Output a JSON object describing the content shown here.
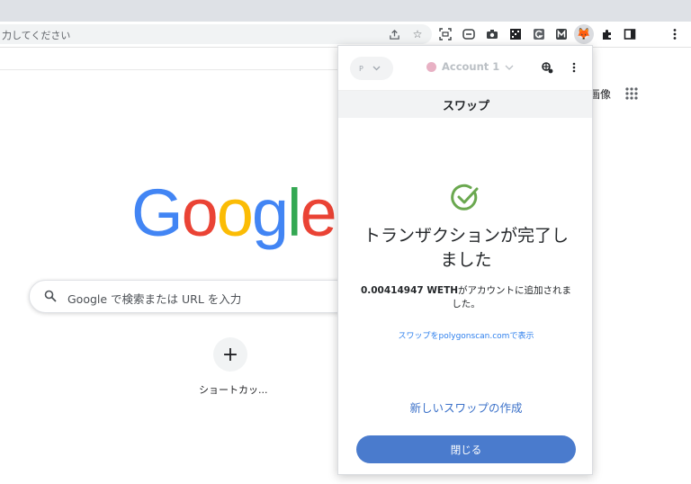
{
  "browser": {
    "omnibox_text": "力してください"
  },
  "google": {
    "logo_letters": [
      {
        "ch": "G",
        "color": "#4285f4"
      },
      {
        "ch": "o",
        "color": "#ea4335"
      },
      {
        "ch": "o",
        "color": "#fbbc05"
      },
      {
        "ch": "g",
        "color": "#4285f4"
      },
      {
        "ch": "l",
        "color": "#34a853"
      },
      {
        "ch": "e",
        "color": "#ea4335"
      }
    ],
    "images_link": "画像",
    "search_placeholder": "Google で検索または URL を入力",
    "shortcut_add_icon": "+",
    "shortcut_label": "ショートカッ..."
  },
  "metamask": {
    "network_label": "P",
    "account_name": "Account 1",
    "title": "スワップ",
    "result_title": "トランザクションが完了しました",
    "amount": "0.00414947 WETH",
    "amount_suffix": "がアカウントに追加されました。",
    "explorer_link": "スワップをpolygonscan.comで表示",
    "new_swap": "新しいスワップの作成",
    "close_button": "閉じる",
    "colors": {
      "primary": "#4a7bcd",
      "success": "#6aa84f",
      "link": "#2f80ed"
    }
  },
  "icons": [
    "share-icon",
    "star-icon",
    "screenshot-icon",
    "extension-icon",
    "camera-icon",
    "qr-icon",
    "grammarly-icon",
    "m-icon",
    "metamask-fox-icon",
    "puzzle-icon",
    "sidepanel-icon",
    "kebab-menu-icon"
  ]
}
